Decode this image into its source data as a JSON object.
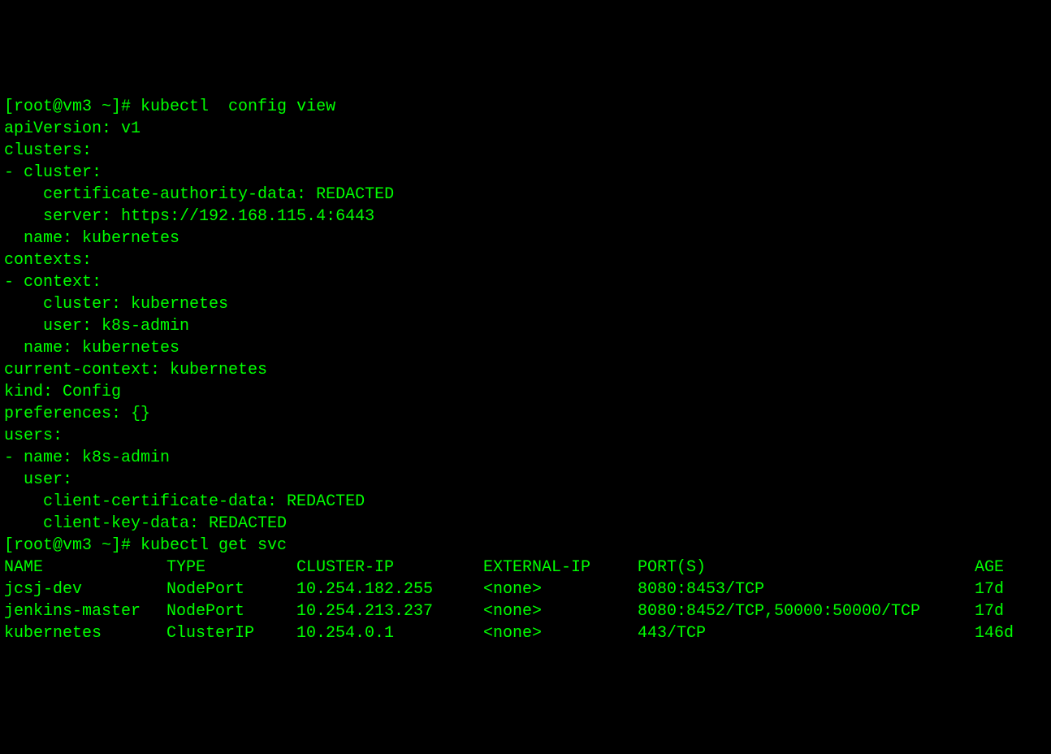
{
  "terminal": {
    "prompt1": "[root@vm3 ~]# ",
    "cmd1": "kubectl  config view",
    "config_output": "apiVersion: v1\nclusters:\n- cluster:\n    certificate-authority-data: REDACTED\n    server: https://192.168.115.4:6443\n  name: kubernetes\ncontexts:\n- context:\n    cluster: kubernetes\n    user: k8s-admin\n  name: kubernetes\ncurrent-context: kubernetes\nkind: Config\npreferences: {}\nusers:\n- name: k8s-admin\n  user:\n    client-certificate-data: REDACTED\n    client-key-data: REDACTED",
    "prompt2": "[root@vm3 ~]# ",
    "cmd2": "kubectl get svc",
    "svc_headers": {
      "name": "NAME",
      "type": "TYPE",
      "cluster_ip": "CLUSTER-IP",
      "external_ip": "EXTERNAL-IP",
      "ports": "PORT(S)",
      "age": "AGE"
    },
    "svc_rows": [
      {
        "name": "jcsj-dev",
        "type": "NodePort",
        "cluster_ip": "10.254.182.255",
        "external_ip": "<none>",
        "ports": "8080:8453/TCP",
        "age": "17d"
      },
      {
        "name": "jenkins-master",
        "type": "NodePort",
        "cluster_ip": "10.254.213.237",
        "external_ip": "<none>",
        "ports": "8080:8452/TCP,50000:50000/TCP",
        "age": "17d"
      },
      {
        "name": "kubernetes",
        "type": "ClusterIP",
        "cluster_ip": "10.254.0.1",
        "external_ip": "<none>",
        "ports": "443/TCP",
        "age": "146d"
      }
    ]
  }
}
